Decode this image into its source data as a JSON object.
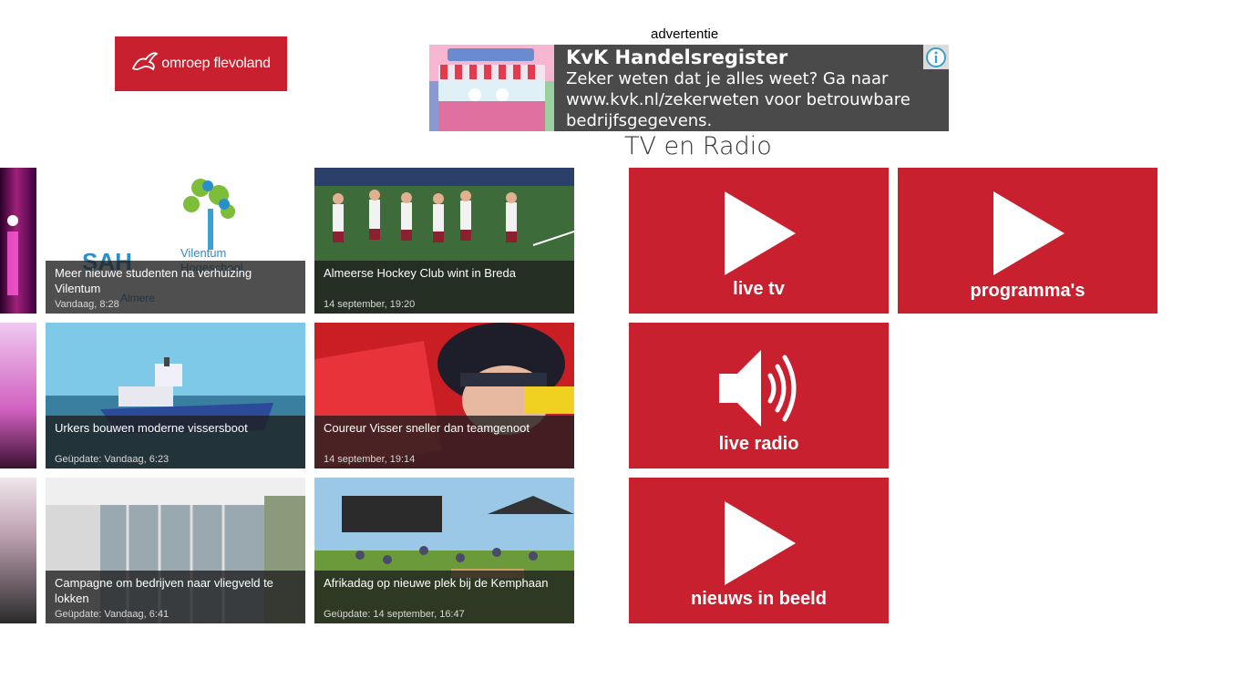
{
  "brand": {
    "logo_text": "omroep flevoland"
  },
  "ad": {
    "label": "advertentie",
    "title": "KvK Handelsregister",
    "text": "Zeker weten dat je alles weet? Ga naar www.kvk.nl/zekerweten voor betrouwbare bedrijfsgegevens."
  },
  "section": {
    "title": "TV en Radio"
  },
  "news": [
    {
      "title": "Meer nieuwe studenten na verhuizing Vilentum",
      "date": "Vandaag, 8:28"
    },
    {
      "title": "Almeerse Hockey Club wint in Breda",
      "date": "14 september, 19:20"
    },
    {
      "title": "Urkers bouwen moderne vissersboot",
      "date": "Geüpdate: Vandaag, 6:23"
    },
    {
      "title": "Coureur Visser sneller dan teamgenoot",
      "date": "14 september, 19:14"
    },
    {
      "title": "Campagne om bedrijven naar vliegveld te lokken",
      "date": "Geüpdate: Vandaag, 6:41"
    },
    {
      "title": "Afrikadag op nieuwe plek bij de Kemphaan",
      "date": "Geüpdate: 14 september, 16:47"
    }
  ],
  "media": [
    {
      "label": "live tv",
      "icon": "play-icon"
    },
    {
      "label": "programma's",
      "icon": "play-icon"
    },
    {
      "label": "live radio",
      "icon": "speaker-icon"
    },
    {
      "label": "nieuws in beeld",
      "icon": "play-icon"
    }
  ],
  "colors": {
    "brand_red": "#c8202f",
    "ad_bg": "#4a4a4a"
  }
}
